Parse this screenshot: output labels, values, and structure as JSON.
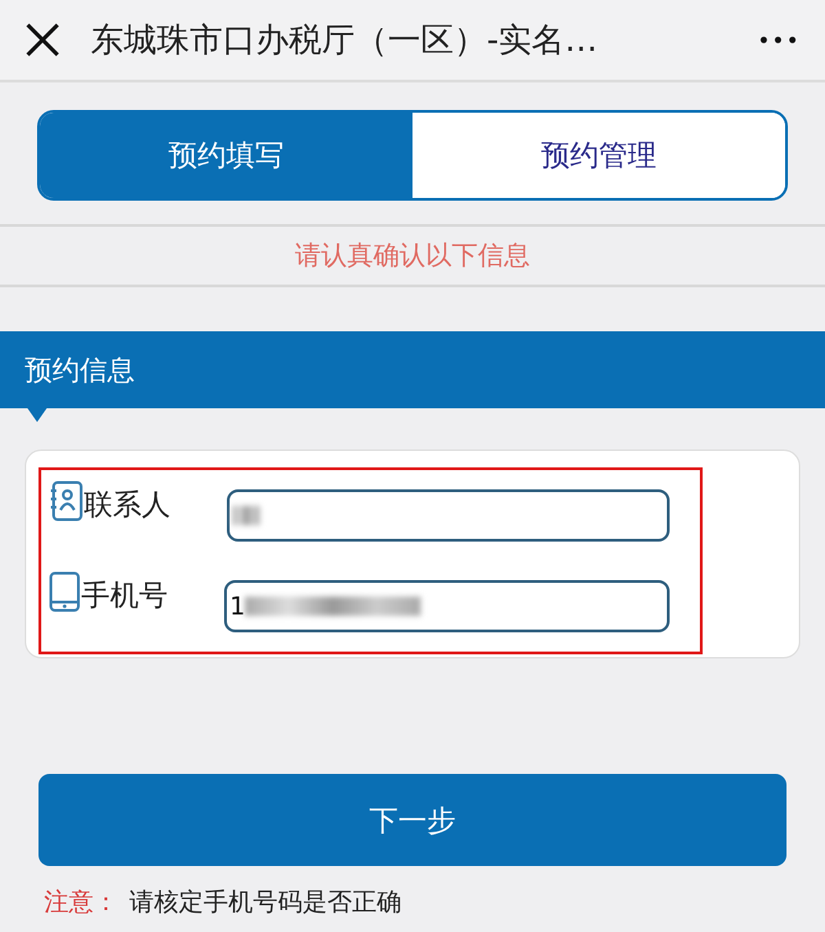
{
  "header": {
    "title": "东城珠市口办税厅（一区）-实名…",
    "more": "•••"
  },
  "tabs": [
    {
      "label": "预约填写",
      "selected": true
    },
    {
      "label": "预约管理",
      "selected": false
    }
  ],
  "notice": "请认真确认以下信息",
  "section": {
    "title": "预约信息"
  },
  "fields": [
    {
      "kind": "contact",
      "label": "联系人",
      "redacted": true
    },
    {
      "kind": "phone",
      "label": "手机号",
      "value": "1",
      "redacted": true
    }
  ],
  "button": "下一步",
  "note": {
    "label": "注意：",
    "text": "请核定手机号码是否正确"
  }
}
